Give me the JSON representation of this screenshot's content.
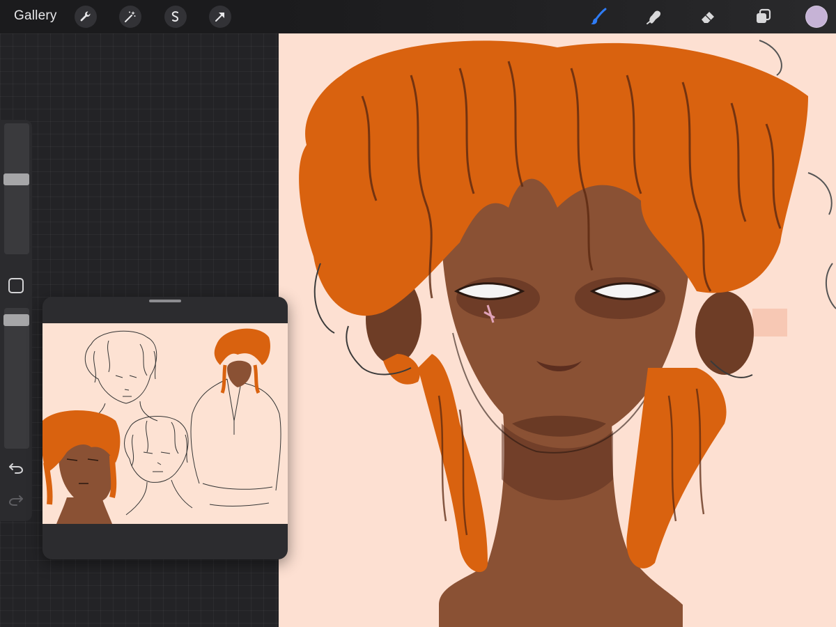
{
  "app": {
    "gallery_label": "Gallery"
  },
  "toolbar": {
    "actions": [
      "wrench-icon",
      "magic-wand-icon",
      "selection-icon",
      "transform-arrow-icon"
    ],
    "tools": [
      "brush-icon",
      "smudge-icon",
      "eraser-icon",
      "layers-icon"
    ],
    "active_tool": "brush-icon",
    "current_color": "#c6b3d6"
  },
  "colors": {
    "canvas_background": "#fde0d2",
    "hair": "#d9620f",
    "skin": "#8a5134",
    "active_tool": "#2f7cf6"
  },
  "sidebar": {
    "brush_size": 0.58,
    "opacity": 0.95,
    "controls": [
      "brush-size-slider",
      "modify-button",
      "opacity-slider",
      "undo-icon",
      "redo-icon"
    ]
  },
  "reference": {
    "panel": "reference-window"
  }
}
